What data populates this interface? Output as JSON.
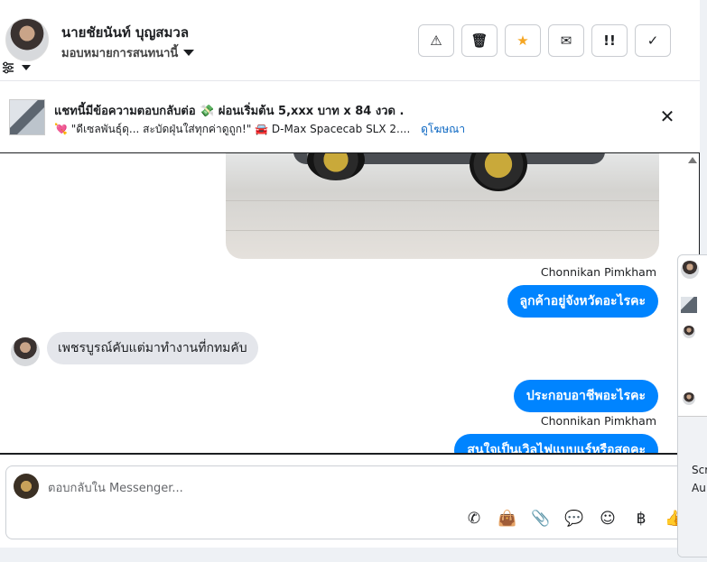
{
  "header": {
    "contact_name": "นายชัยนันท์ บุญสมวล",
    "assign_label": "มอบหมายการสนทนานี้",
    "actions": [
      {
        "name": "report-spam-button",
        "icon": "warning-icon",
        "glyph": "⚠",
        "color": "#1c1e21"
      },
      {
        "name": "delete-button",
        "icon": "trash-icon",
        "glyph": "🗑",
        "color": "#1c1e21"
      },
      {
        "name": "star-button",
        "icon": "star-icon",
        "glyph": "★",
        "color": "#f5a623"
      },
      {
        "name": "mark-unread-button",
        "icon": "envelope-icon",
        "glyph": "✉",
        "color": "#1c1e21"
      },
      {
        "name": "follow-up-button",
        "icon": "priority-icon",
        "glyph": "!!",
        "color": "#1c1e21"
      },
      {
        "name": "mark-done-button",
        "icon": "check-icon",
        "glyph": "✓",
        "color": "#1c1e21"
      }
    ]
  },
  "ad": {
    "title": "แชทนี้มีข้อความตอบกลับต่อ 💸 ผ่อนเริ่มต้น 5,xxx บาท x 84 งวด .",
    "subtitle": "💘 \"ดีเซลพันธุ์ดุ... สะบัดฝุ่นใส่ทุกค่าดูถูก!\" 🚘 D-Max Spacecab SLX 2....",
    "link": "ดูโฆษณา"
  },
  "messages": {
    "sender_1": "Chonnikan Pimkham",
    "out_1": "ลูกค้าอยู่จังหวัดอะไรคะ",
    "in_1": "เพชรบูรณ์คับแต่มาทำงานที่กทมคับ",
    "out_2": "ประกอบอาชีพอะไรคะ",
    "sender_2": "Chonnikan Pimkham",
    "out_3": "สนใจเป็นเวิลไฟแบบแร์หรือสดคะ"
  },
  "composer": {
    "placeholder": "ตอบกลับใน Messenger...",
    "tools": [
      {
        "name": "call-button",
        "icon": "phone-add-icon",
        "glyph": "✆"
      },
      {
        "name": "shop-button",
        "icon": "shopping-bag-icon",
        "glyph": "👜"
      },
      {
        "name": "attach-button",
        "icon": "paperclip-icon",
        "glyph": "📎"
      },
      {
        "name": "saved-replies-button",
        "icon": "chat-bubble-icon",
        "glyph": "💬"
      },
      {
        "name": "emoji-button",
        "icon": "smiley-icon",
        "glyph": "☺"
      },
      {
        "name": "payment-button",
        "icon": "baht-icon",
        "glyph": "฿"
      },
      {
        "name": "like-button",
        "icon": "thumbs-up-icon",
        "glyph": "👍"
      }
    ]
  },
  "side_panel": {
    "text_1": "Scr",
    "text_2": "Au"
  }
}
